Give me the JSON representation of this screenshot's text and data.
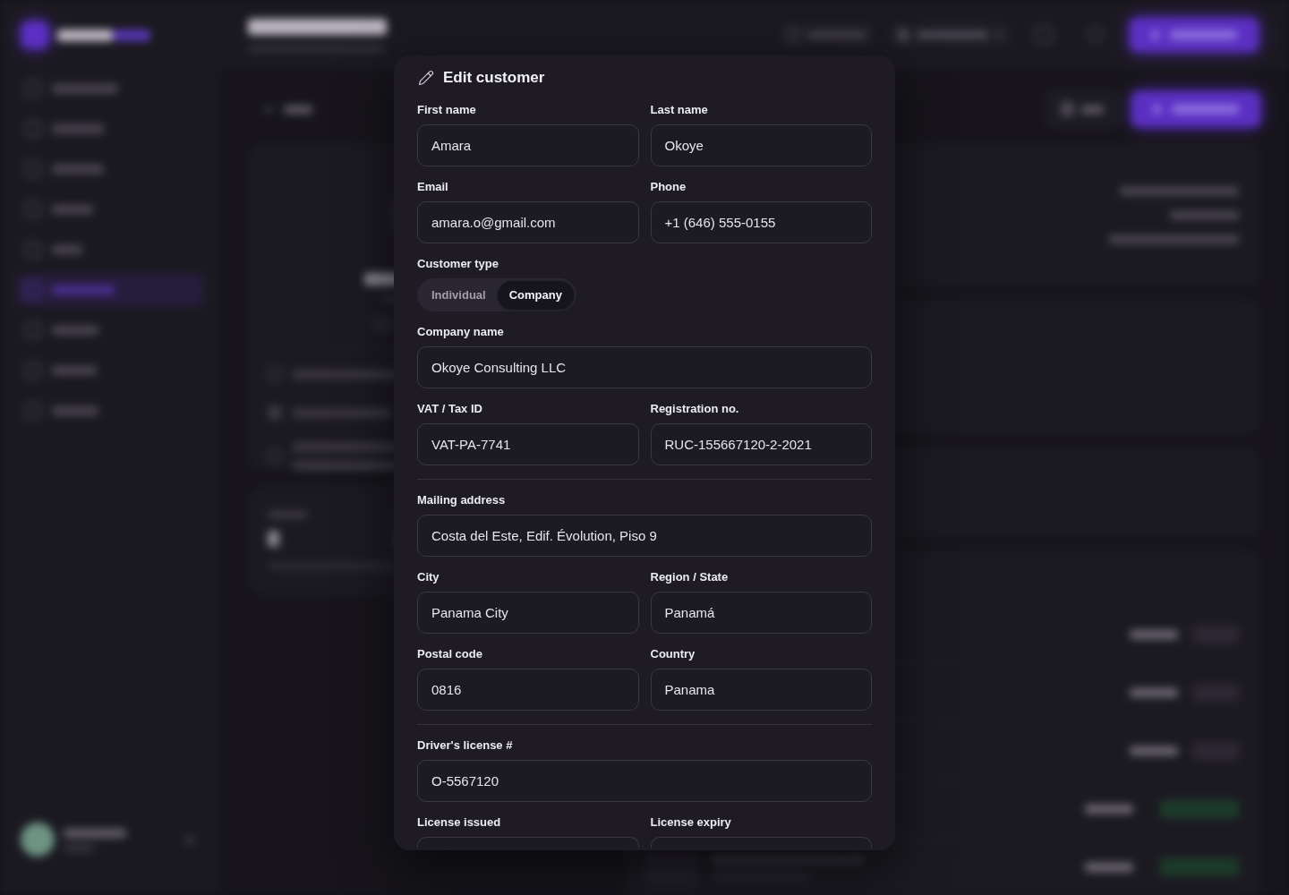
{
  "dialog": {
    "title": "Edit customer",
    "rows": [
      {
        "kind": "fields",
        "fields": [
          {
            "label": "First name",
            "value": "Amara"
          },
          {
            "label": "Last name",
            "value": "Okoye"
          }
        ]
      },
      {
        "kind": "fields",
        "fields": [
          {
            "label": "Email",
            "value": "amara.o@gmail.com"
          },
          {
            "label": "Phone",
            "value": "+1 (646) 555-0155"
          }
        ]
      },
      {
        "kind": "choice",
        "label": "Customer type",
        "options": [
          {
            "label": "Individual",
            "selected": false
          },
          {
            "label": "Company",
            "selected": true
          }
        ]
      },
      {
        "kind": "fields",
        "fields": [
          {
            "label": "Company name",
            "value": "Okoye Consulting LLC"
          }
        ]
      },
      {
        "kind": "fields",
        "fields": [
          {
            "label": "VAT / Tax ID",
            "value": "VAT-PA-7741"
          },
          {
            "label": "Registration no.",
            "value": "RUC-155667120-2-2021"
          }
        ]
      },
      {
        "kind": "divider"
      },
      {
        "kind": "fields",
        "fields": [
          {
            "label": "Mailing address",
            "value": "Costa del Este, Edif. Évolution, Piso 9"
          }
        ]
      },
      {
        "kind": "fields",
        "fields": [
          {
            "label": "City",
            "value": "Panama City"
          },
          {
            "label": "Region / State",
            "value": "Panamá"
          }
        ]
      },
      {
        "kind": "fields",
        "fields": [
          {
            "label": "Postal code",
            "value": "0816"
          },
          {
            "label": "Country",
            "value": "Panama"
          }
        ]
      },
      {
        "kind": "divider"
      },
      {
        "kind": "fields",
        "fields": [
          {
            "label": "Driver's license #",
            "value": "O-5567120"
          }
        ]
      },
      {
        "kind": "fields",
        "fields": [
          {
            "label": "License issued"
          },
          {
            "label": "License expiry"
          }
        ]
      }
    ]
  }
}
